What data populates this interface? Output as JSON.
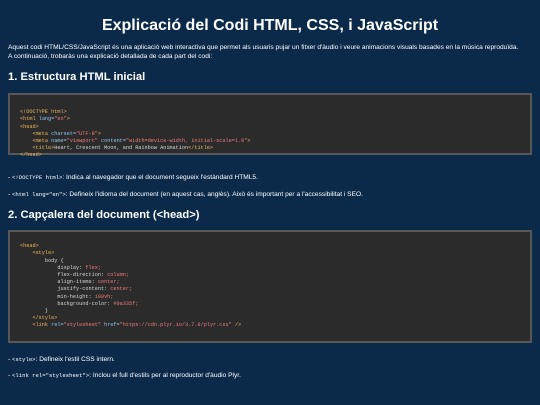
{
  "page": {
    "title": "Explicació del Codi HTML, CSS, i JavaScript",
    "intro_line1": "Aquest codi HTML/CSS/JavaScript és una aplicació web interactiva que permet als usuaris pujar un fitxer d'àudio i veure animacions visuals basades en la música reproduïda.",
    "intro_line2": "A continuació, trobaràs una explicació detallada de cada part del codi:"
  },
  "colors": {
    "background": "#0b2a4a",
    "code_background": "#2b2b2b",
    "code_border": "#585858",
    "tag": "#f0b45a",
    "attribute": "#8fc7ee",
    "string": "#f07c7c"
  },
  "sections": [
    {
      "heading": "1. Estructura HTML inicial",
      "code": {
        "l1_tag": "<!DOCTYPE html>",
        "l2_open": "<html",
        "l2_attr": "lang=",
        "l2_val": "\"en\"",
        "l2_close": ">",
        "l3": "<head>",
        "l4_open": "<meta",
        "l4_attr": "charset=",
        "l4_val": "\"UTF-8\"",
        "l4_close": ">",
        "l5_open": "<meta",
        "l5_attr1": "name=",
        "l5_val1": "\"viewport\"",
        "l5_attr2": "content=",
        "l5_val2": "\"width=device-width, initial-scale=1.0\"",
        "l5_close": ">",
        "l6_open": "<title>",
        "l6_text": "Heart, Crescent Moon, and Rainbow Animation",
        "l6_close": "</title>",
        "l7": "</head>"
      },
      "notes": [
        {
          "code": "<!DOCTYPE html>",
          "text": ": Indica al navegador que el document segueix l'estàndard HTML5."
        },
        {
          "code": "<html lang=\"en\">",
          "text": ": Defineix l'idioma del document (en aquest cas, anglès). Això és important per a l'accessibilitat i SEO."
        }
      ]
    },
    {
      "heading": "2. Capçalera del document (<head>)",
      "code": {
        "l1": "<head>",
        "l2": "<style>",
        "l3": "body {",
        "l4_p": "display:",
        "l4_v": "flex;",
        "l5_p": "flex-direction:",
        "l5_v": "column;",
        "l6_p": "align-items:",
        "l6_v": "center;",
        "l7_p": "justify-content:",
        "l7_v": "center;",
        "l8_p": "min-height:",
        "l8_v": "100vh;",
        "l9_p": "background-color:",
        "l9_v": "#0a335f;",
        "l10": "}",
        "l11": "</style>",
        "l12_open": "<link",
        "l12_attr1": "rel=",
        "l12_val1": "\"stylesheet\"",
        "l12_attr2": "href=",
        "l12_val2": "\"https://cdn.plyr.io/3.7.8/plyr.css\"",
        "l12_close": "/>"
      },
      "notes": [
        {
          "code": "<style>",
          "text": ": Defineix l'estil CSS intern."
        },
        {
          "code": "<link rel=\"stylesheet\">",
          "text": ": Inclou el full d'estils per al reproductor d'àudio Plyr."
        }
      ]
    }
  ]
}
